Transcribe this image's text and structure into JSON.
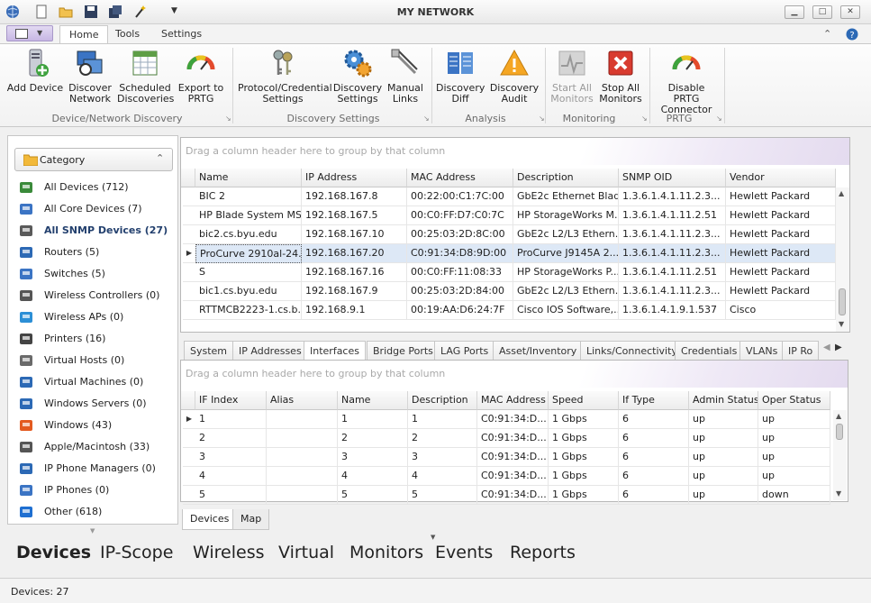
{
  "window": {
    "title": "MY NETWORK"
  },
  "ribbon_tabs": [
    "Home",
    "Tools",
    "Settings"
  ],
  "ribbon": {
    "buttons": [
      {
        "label1": "Add Device",
        "label2": ""
      },
      {
        "label1": "Discover",
        "label2": "Network"
      },
      {
        "label1": "Scheduled",
        "label2": "Discoveries"
      },
      {
        "label1": "Export to",
        "label2": "PRTG"
      },
      {
        "label1": "Protocol/Credential",
        "label2": "Settings"
      },
      {
        "label1": "Discovery",
        "label2": "Settings"
      },
      {
        "label1": "Manual",
        "label2": "Links"
      },
      {
        "label1": "Discovery",
        "label2": "Diff"
      },
      {
        "label1": "Discovery",
        "label2": "Audit"
      },
      {
        "label1": "Start All",
        "label2": "Monitors"
      },
      {
        "label1": "Stop All",
        "label2": "Monitors"
      },
      {
        "label1": "Disable PRTG",
        "label2": "Connector"
      }
    ],
    "groups": [
      "Device/Network Discovery",
      "Discovery Settings",
      "Analysis",
      "Monitoring",
      "PRTG"
    ]
  },
  "category": {
    "header": "Category",
    "items": [
      {
        "label": "All Devices (712)",
        "icon": "globe-icon"
      },
      {
        "label": "All Core Devices (7)",
        "icon": "core-devices-icon"
      },
      {
        "label": "All SNMP Devices (27)",
        "icon": "snmp-icon"
      },
      {
        "label": "Routers (5)",
        "icon": "router-icon"
      },
      {
        "label": "Switches (5)",
        "icon": "switch-icon"
      },
      {
        "label": "Wireless Controllers (0)",
        "icon": "wireless-controller-icon"
      },
      {
        "label": "Wireless APs (0)",
        "icon": "wireless-ap-icon"
      },
      {
        "label": "Printers (16)",
        "icon": "printer-icon"
      },
      {
        "label": "Virtual Hosts (0)",
        "icon": "virtual-host-icon"
      },
      {
        "label": "Virtual Machines (0)",
        "icon": "virtual-machine-icon"
      },
      {
        "label": "Windows Servers (0)",
        "icon": "windows-server-icon"
      },
      {
        "label": "Windows (43)",
        "icon": "windows-icon"
      },
      {
        "label": "Apple/Macintosh (33)",
        "icon": "apple-icon"
      },
      {
        "label": "IP Phone Managers (0)",
        "icon": "ip-phone-manager-icon"
      },
      {
        "label": "IP Phones (0)",
        "icon": "ip-phone-icon"
      },
      {
        "label": "Other (618)",
        "icon": "question-icon"
      }
    ]
  },
  "devices_grid": {
    "group_hint": "Drag a column header here to group by that column",
    "columns": [
      "Name",
      "IP Address",
      "MAC Address",
      "Description",
      "SNMP OID",
      "Vendor"
    ],
    "rows": [
      [
        "BIC 2",
        "192.168.167.8",
        "00:22:00:C1:7C:00",
        "GbE2c Ethernet Blad...",
        "1.3.6.1.4.1.11.2.3...",
        "Hewlett Packard"
      ],
      [
        "HP Blade System MS...",
        "192.168.167.5",
        "00:C0:FF:D7:C0:7C",
        "HP StorageWorks M...",
        "1.3.6.1.4.1.11.2.51",
        "Hewlett Packard"
      ],
      [
        "bic2.cs.byu.edu",
        "192.168.167.10",
        "00:25:03:2D:8C:00",
        "GbE2c L2/L3 Ethern...",
        "1.3.6.1.4.1.11.2.3...",
        "Hewlett Packard"
      ],
      [
        "ProCurve 2910al-24...",
        "192.168.167.20",
        "C0:91:34:D8:9D:00",
        "ProCurve J9145A 2...",
        "1.3.6.1.4.1.11.2.3...",
        "Hewlett Packard"
      ],
      [
        "S",
        "192.168.167.16",
        "00:C0:FF:11:08:33",
        "HP StorageWorks P...",
        "1.3.6.1.4.1.11.2.51",
        "Hewlett Packard"
      ],
      [
        "bic1.cs.byu.edu",
        "192.168.167.9",
        "00:25:03:2D:84:00",
        "GbE2c L2/L3 Ethern...",
        "1.3.6.1.4.1.11.2.3...",
        "Hewlett Packard"
      ],
      [
        "RTTMCB2223-1.cs.b...",
        "192.168.9.1",
        "00:19:AA:D6:24:7F",
        "Cisco IOS Software,...",
        "1.3.6.1.4.1.9.1.537",
        "Cisco"
      ]
    ]
  },
  "detail_tabs": [
    "System",
    "IP Addresses",
    "Interfaces",
    "Bridge Ports",
    "LAG Ports",
    "Asset/Inventory",
    "Links/Connectivity",
    "Credentials",
    "VLANs",
    "IP Ro"
  ],
  "interfaces_grid": {
    "group_hint": "Drag a column header here to group by that column",
    "columns": [
      "IF Index",
      "Alias",
      "Name",
      "Description",
      "MAC Address",
      "Speed",
      "If Type",
      "Admin Status",
      "Oper Status"
    ],
    "rows": [
      [
        "1",
        "",
        "1",
        "1",
        "C0:91:34:D...",
        "1 Gbps",
        "6",
        "up",
        "up"
      ],
      [
        "2",
        "",
        "2",
        "2",
        "C0:91:34:D...",
        "1 Gbps",
        "6",
        "up",
        "up"
      ],
      [
        "3",
        "",
        "3",
        "3",
        "C0:91:34:D...",
        "1 Gbps",
        "6",
        "up",
        "up"
      ],
      [
        "4",
        "",
        "4",
        "4",
        "C0:91:34:D...",
        "1 Gbps",
        "6",
        "up",
        "up"
      ],
      [
        "5",
        "",
        "5",
        "5",
        "C0:91:34:D...",
        "1 Gbps",
        "6",
        "up",
        "down"
      ]
    ]
  },
  "view_tabs": [
    "Devices",
    "Map"
  ],
  "nav": [
    "Devices",
    "IP-Scope",
    "Wireless",
    "Virtual",
    "Monitors",
    "Events",
    "Reports"
  ],
  "status": {
    "text": "Devices: 27"
  },
  "colors": {
    "selected_row": "#dde8f6",
    "accent": "#2b5797"
  }
}
